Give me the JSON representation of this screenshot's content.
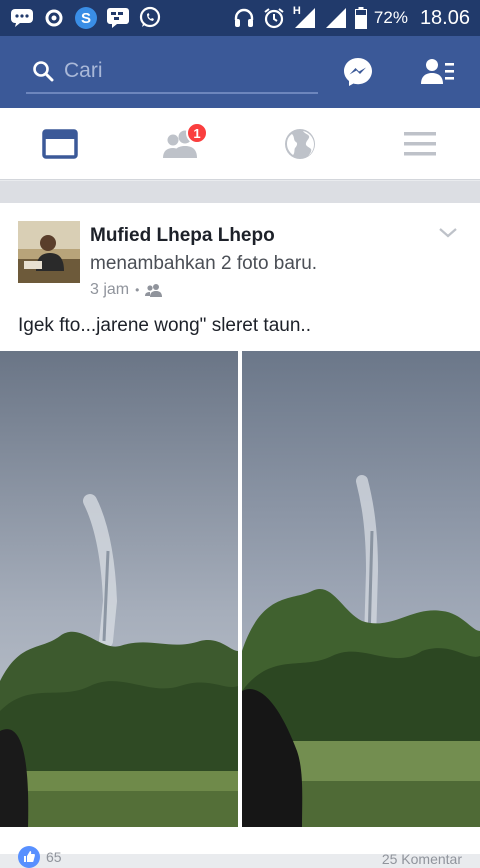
{
  "status_bar": {
    "battery": "72%",
    "time": "18.06",
    "network_label": "H"
  },
  "search": {
    "placeholder": "Cari"
  },
  "nav": {
    "friend_requests_badge": "1"
  },
  "post": {
    "author": "Mufied Lhepa Lhepo",
    "action": "menambahkan 2 foto baru.",
    "time": "3 jam",
    "separator": "•",
    "text": "Igek fto...jarene wong\" sleret taun..",
    "likes": "65",
    "comments": "25 Komentar"
  },
  "colors": {
    "status_bar": "#213a6b",
    "header": "#3b5998",
    "badge": "#fa3e3e"
  }
}
